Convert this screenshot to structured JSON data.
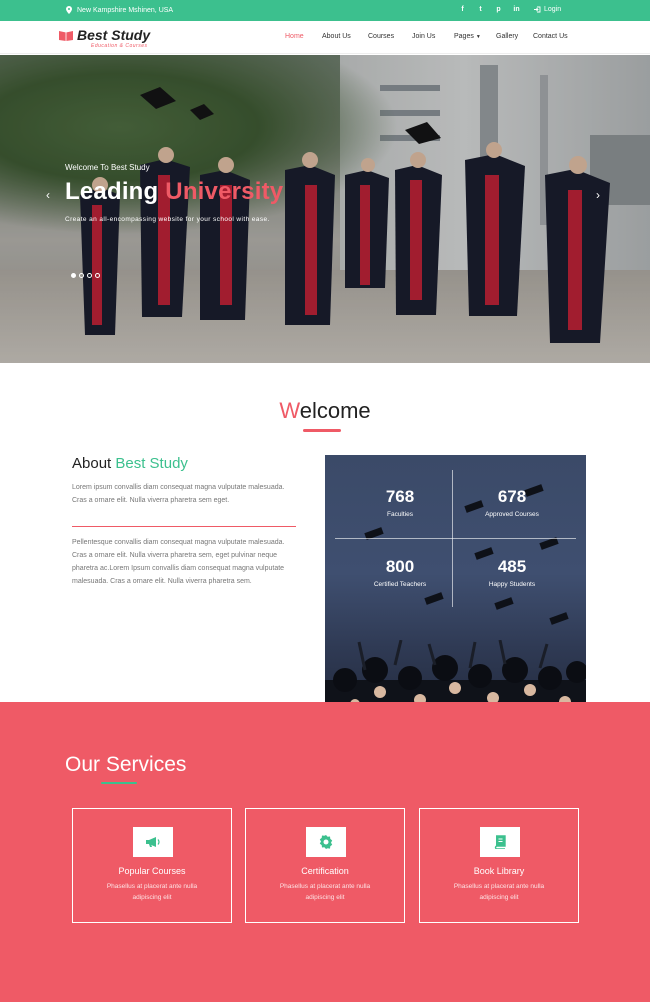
{
  "topbar": {
    "address": "New Kampshire Mshinen, USA",
    "social": [
      {
        "icon": "facebook-icon",
        "glyph": "f"
      },
      {
        "icon": "twitter-icon",
        "glyph": "t"
      },
      {
        "icon": "pinterest-icon",
        "glyph": "p"
      },
      {
        "icon": "linkedin-icon",
        "glyph": "in"
      }
    ],
    "login_label": "Login"
  },
  "header": {
    "logo_name": "Best Study",
    "logo_tagline": "Education & Courses",
    "nav": [
      "Home",
      "About Us",
      "Courses",
      "Join Us",
      "Pages",
      "Gallery",
      "Contact Us"
    ],
    "active_nav": "Home"
  },
  "hero": {
    "kicker": "Welcome To Best Study",
    "title_plain": "Leading ",
    "title_highlight": "University",
    "subtitle": "Create an all-encompassing website for your school with ease.",
    "slide_count": 4,
    "active_slide": 1
  },
  "welcome": {
    "title_first": "W",
    "title_rest": "elcome"
  },
  "about": {
    "title_plain": "About ",
    "title_highlight": "Best Study",
    "paragraph1": "Lorem ipsum convallis diam consequat magna vulputate malesuada. Cras a ornare elit. Nulla viverra pharetra sem eget.",
    "paragraph2": "Pellentesque convallis diam consequat magna vulputate malesuada. Cras a ornare elit. Nulla viverra pharetra sem, eget pulvinar neque pharetra ac.Lorem Ipsum convallis diam consequat magna vulputate malesuada. Cras a ornare elit. Nulla viverra pharetra sem."
  },
  "stats": [
    {
      "number": "768",
      "label": "Faculties"
    },
    {
      "number": "678",
      "label": "Approved Courses"
    },
    {
      "number": "800",
      "label": "Certified Teachers"
    },
    {
      "number": "485",
      "label": "Happy Students"
    }
  ],
  "services": {
    "title_first": "O",
    "title_rest": "ur ",
    "title_first2": "S",
    "title_rest2": "ervices",
    "cards": [
      {
        "icon": "megaphone-icon",
        "title": "Popular Courses",
        "desc": "Phasellus at placerat ante nulla adipiscing elit"
      },
      {
        "icon": "badge-icon",
        "title": "Certification",
        "desc": "Phasellus at placerat ante nulla adipiscing elit"
      },
      {
        "icon": "book-icon",
        "title": "Book Library",
        "desc": "Phasellus at placerat ante nulla adipiscing elit"
      }
    ]
  },
  "colors": {
    "green": "#3cc08e",
    "red": "#ef5a66",
    "dark": "#222222"
  }
}
